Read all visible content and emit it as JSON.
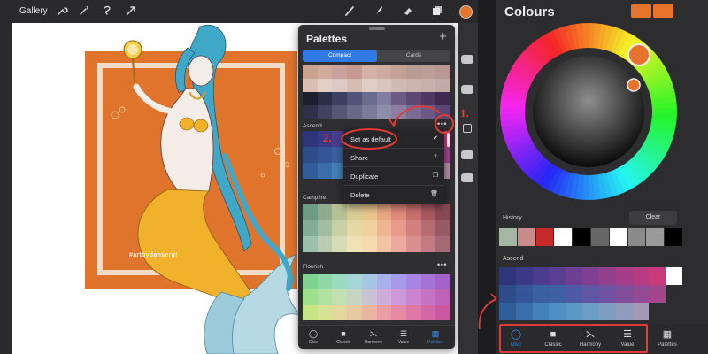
{
  "topbar": {
    "gallery_label": "Gallery",
    "left_tools": [
      "wrench-icon",
      "magic-wand-icon",
      "selection-icon",
      "transform-arrow-icon"
    ],
    "right_tools": [
      "brush-icon",
      "smudge-icon",
      "eraser-icon",
      "layers-icon"
    ],
    "current_color": "#e8732a"
  },
  "canvas": {
    "watermark": "#artbydanserg!"
  },
  "palettes": {
    "title": "Palettes",
    "add_icon": "plus-icon",
    "segments": {
      "compact": "Compact",
      "cards": "Cards"
    },
    "top_palette": {
      "rows": [
        [
          "#caa390",
          "#d1ab9a",
          "#c9a29f",
          "#c69991",
          "#d3b1a6",
          "#cdaa9e",
          "#c3a195",
          "#b89b93",
          "#bc9e98",
          "#ba9792"
        ],
        [
          "#d8bfb1",
          "#e2cfc5",
          "#dcc9c3",
          "#d4bcb3",
          "#e0cdc5",
          "#d9c5be",
          "#d1bab2",
          "#cbb4ad",
          "#c9b1aa",
          "#c2aaa4"
        ],
        [
          "#1c1e2e",
          "#2b2e47",
          "#3f4061",
          "#525477",
          "#6a6c8d",
          "#7f7ea0",
          "#6c5b83",
          "#5d4772",
          "#4f3762",
          "#3e2a50"
        ],
        [
          "#2f3049",
          "#40425f",
          "#545673",
          "#676986",
          "#7b7b98",
          "#8f8eaa",
          "#8a7ea2",
          "#7a6a94",
          "#6a5985",
          "#594874"
        ]
      ]
    },
    "ascend": {
      "label": "Ascend",
      "more_icon": "more-dots-icon",
      "rows": [
        [
          "#2e3578",
          "#3a3a86",
          "#4a3d8e",
          "#5a3e92",
          "#6c3f93",
          "#7f3f92",
          "#923f8e",
          "#a53e89",
          "#b83c82",
          "#c93a7b"
        ],
        [
          "#2e4c8a",
          "#345698",
          "#3a60a0",
          "#4060a4",
          "#4e5aa6",
          "#6056a6",
          "#7052a2",
          "#824e9c",
          "#944a94",
          "#a4468c"
        ],
        [
          "#2f5e9a",
          "#3a6fab",
          "#4580b8",
          "#4f8ec2",
          "#5a98c6",
          "#6a9ec6",
          "#7e9ec2",
          "#919cbc",
          "#a498b4",
          "#b694ac"
        ]
      ]
    },
    "context_menu": {
      "items": [
        {
          "label": "Set as default",
          "icon": "checkmark-icon"
        },
        {
          "label": "Share",
          "icon": "share-icon"
        },
        {
          "label": "Duplicate",
          "icon": "duplicate-icon"
        },
        {
          "label": "Delete",
          "icon": "trash-icon"
        }
      ]
    },
    "campfire": {
      "label": "Campfire",
      "rows": [
        [
          "#6f9a84",
          "#8fab8e",
          "#b7c196",
          "#d9cd96",
          "#e9c68c",
          "#eaa882",
          "#e08a7a",
          "#c9706e",
          "#a85a60",
          "#8a4a54"
        ],
        [
          "#84ad97",
          "#a4bd9f",
          "#c8cfa5",
          "#e5d8a5",
          "#f0d09b",
          "#efb692",
          "#e79a8a",
          "#d2807e",
          "#b56b70",
          "#975a63"
        ],
        [
          "#9cc0aa",
          "#b8cdb2",
          "#d6dcb6",
          "#efe2b6",
          "#f5daae",
          "#f3c3a4",
          "#eca99c",
          "#db9090",
          "#c27b82",
          "#a56975"
        ]
      ]
    },
    "flourish": {
      "label": "Flourish",
      "more_icon": "more-dots-icon",
      "rows": [
        [
          "#7fd18e",
          "#8ed7a6",
          "#9bdcc0",
          "#a3d6d6",
          "#a6c6e2",
          "#a7b2ea",
          "#a69bea",
          "#a785e2",
          "#a772d6",
          "#a262c8"
        ],
        [
          "#9ddf8a",
          "#b2e2a0",
          "#c2e0b2",
          "#c8d4c2",
          "#cac2d2",
          "#cbadd8",
          "#cc98d8",
          "#ca84d0",
          "#c672c4",
          "#bf62b6"
        ],
        [
          "#c6e584",
          "#d6e294",
          "#e2d89e",
          "#e8c8a0",
          "#e9b4a0",
          "#e89ea2",
          "#e48aa4",
          "#dd78a6",
          "#d468a6",
          "#c85aa2"
        ]
      ]
    },
    "tabs": [
      {
        "label": "Disc",
        "icon": "disc-icon",
        "active": false
      },
      {
        "label": "Classic",
        "icon": "classic-square-icon",
        "active": false
      },
      {
        "label": "Harmony",
        "icon": "harmony-icon",
        "active": false
      },
      {
        "label": "Value",
        "icon": "value-sliders-icon",
        "active": false
      },
      {
        "label": "Palettes",
        "icon": "palettes-grid-icon",
        "active": true
      }
    ]
  },
  "annotations": {
    "step1": "1.",
    "step2": "2."
  },
  "colours_panel": {
    "title": "Colours",
    "current_colors": [
      "#e8732a",
      "#e8732a"
    ],
    "history_label": "History",
    "clear_label": "Clear",
    "history": [
      "#a4b7a3",
      "#c98c8c",
      "#c72a2a",
      "#ffffff",
      "#000000",
      "#666666",
      "#ffffff",
      "#8a8a8a",
      "#9a9a9a",
      "#000000"
    ],
    "ascend_label": "Ascend",
    "ascend_rows": [
      [
        "#2e3578",
        "#3a3a86",
        "#4a3d8e",
        "#5a3e92",
        "#6c3f93",
        "#7f3f92",
        "#923f8e",
        "#a53e89",
        "#b83c82",
        "#c93a7b",
        "#ffffff"
      ],
      [
        "#2e4c8a",
        "#345698",
        "#3a60a0",
        "#4060a4",
        "#4e5aa6",
        "#6056a6",
        "#7052a2",
        "#824e9c",
        "#944a94",
        "#a4468c",
        "#2d2d2f"
      ],
      [
        "#2f5e9a",
        "#3a6fab",
        "#4580b8",
        "#4f8ec2",
        "#5a98c6",
        "#6a9ec6",
        "#7e9ec2",
        "#919cbc",
        "#a498b4",
        "#2d2d2f",
        "#2d2d2f"
      ]
    ],
    "tabs": [
      {
        "label": "Disc",
        "icon": "disc-icon",
        "active": true
      },
      {
        "label": "Classic",
        "icon": "classic-square-icon",
        "active": false
      },
      {
        "label": "Harmony",
        "icon": "harmony-icon",
        "active": false
      },
      {
        "label": "Value",
        "icon": "value-sliders-icon",
        "active": false
      },
      {
        "label": "Palettes",
        "icon": "palettes-grid-icon",
        "active": false
      }
    ]
  }
}
